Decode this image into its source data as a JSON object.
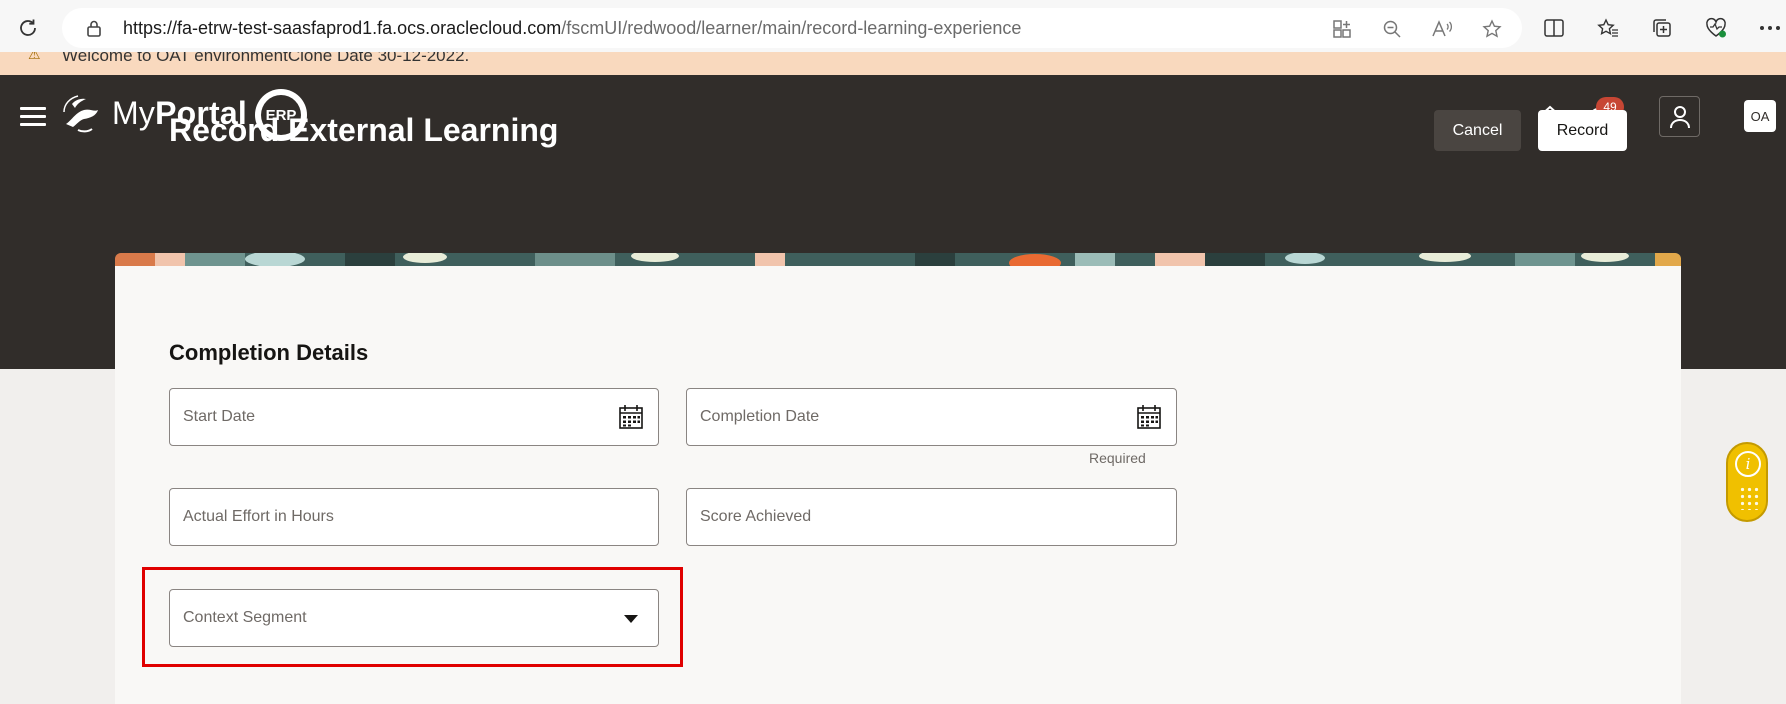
{
  "browser": {
    "url_host": "https://fa-etrw-test-saasfaprod1.fa.ocs.oraclecloud.com",
    "url_path": "/fscmUI/redwood/learner/main/record-learning-experience"
  },
  "notice": {
    "text": "Welcome to OAT environmentClone Date 30-12-2022."
  },
  "header": {
    "brand_prefix": "My",
    "brand_bold": "Portal",
    "erp_badge": "ERP",
    "notification_count": "49",
    "user_initials": "OA"
  },
  "page": {
    "title": "Record External Learning",
    "cancel_label": "Cancel",
    "record_label": "Record"
  },
  "form": {
    "section_title": "Completion Details",
    "start_date_label": "Start Date",
    "completion_date_label": "Completion Date",
    "completion_date_hint": "Required",
    "effort_label": "Actual Effort in Hours",
    "score_label": "Score Achieved",
    "context_segment_label": "Context Segment"
  },
  "icons": {
    "reload": "reload-icon",
    "lock": "lock-icon",
    "hamburger": "hamburger-menu-icon",
    "home": "home-icon",
    "bell": "bell-icon",
    "user": "user-icon",
    "calendar": "calendar-icon",
    "dropdown": "chevron-down-icon",
    "info": "info-icon"
  },
  "colors": {
    "header_bg": "#312d2a",
    "badge_red": "#c74634",
    "highlight_red": "#e00000",
    "widget_yellow": "#f0c000"
  }
}
